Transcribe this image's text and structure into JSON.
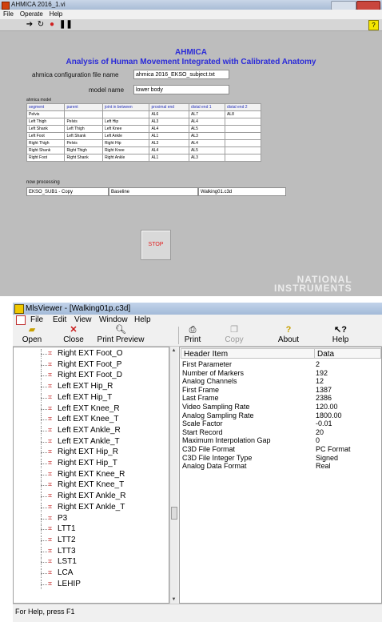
{
  "ahmica": {
    "title": "AHMICA 2016_1.vi",
    "menu": [
      "File",
      "Operate",
      "Help"
    ],
    "heading1": "AHMICA",
    "heading2": "Analysis of Human Movement Integrated with Calibrated Anatomy",
    "config_label": "ahmica configuration file name",
    "config_value": "ahmica 2016_EKSO_subject.txt",
    "model_label": "model name",
    "model_value": "lower body",
    "table_caption": "ahmica model",
    "table_headers": [
      "segment",
      "parent",
      "joint in between",
      "proximal end",
      "distal end 1",
      "distal end 2"
    ],
    "table_rows": [
      [
        "Pelvis",
        "",
        "",
        "AL6",
        "AL7",
        "AL8"
      ],
      [
        "Left Thigh",
        "Pelvis",
        "Left Hip",
        "AL3",
        "AL4",
        ""
      ],
      [
        "Left Shank",
        "Left Thigh",
        "Left Knee",
        "AL4",
        "AL5",
        ""
      ],
      [
        "Left Foot",
        "Left Shank",
        "Left Ankle",
        "AL1",
        "AL3",
        ""
      ],
      [
        "Right Thigh",
        "Pelvis",
        "Right Hip",
        "AL3",
        "AL4",
        ""
      ],
      [
        "Right Shank",
        "Right Thigh",
        "Right Knee",
        "AL4",
        "AL5",
        ""
      ],
      [
        "Right Foot",
        "Right Shank",
        "Right Ankle",
        "AL1",
        "AL3",
        ""
      ]
    ],
    "now_processing_label": "now processing",
    "processing": [
      "EKSO_SUB1 - Copy",
      "Baseline",
      "Walking01.c3d"
    ],
    "stop_label": "STOP",
    "ni_line1": "NATIONAL",
    "ni_line2": "INSTRUMENTS"
  },
  "mls": {
    "title": "MlsViewer - [Walking01p.c3d]",
    "menu": [
      "File",
      "Edit",
      "View",
      "Window",
      "Help"
    ],
    "toolbar": [
      {
        "label": "Open",
        "icon": "open-folder-icon",
        "enabled": true
      },
      {
        "label": "Close",
        "icon": "close-x-icon",
        "enabled": true
      },
      {
        "label": "Print Preview",
        "icon": "print-preview-icon",
        "enabled": true
      },
      {
        "label": "Print",
        "icon": "printer-icon",
        "enabled": true
      },
      {
        "label": "Copy",
        "icon": "copy-icon",
        "enabled": false
      },
      {
        "label": "About",
        "icon": "about-icon",
        "enabled": true
      },
      {
        "label": "Help",
        "icon": "help-icon",
        "enabled": true
      }
    ],
    "tree_items": [
      "Right EXT Foot_O",
      "Right EXT Foot_P",
      "Right EXT Foot_D",
      "Left EXT Hip_R",
      "Left EXT Hip_T",
      "Left EXT Knee_R",
      "Left EXT Knee_T",
      "Left EXT Ankle_R",
      "Left EXT Ankle_T",
      "Right EXT Hip_R",
      "Right EXT Hip_T",
      "Right EXT Knee_R",
      "Right EXT Knee_T",
      "Right EXT Ankle_R",
      "Right EXT Ankle_T",
      "P3",
      "LTT1",
      "LTT2",
      "LTT3",
      "LST1",
      "LCA",
      "LEHIP"
    ],
    "grid_headers": [
      "Header Item",
      "Data"
    ],
    "grid_rows": [
      [
        "First Parameter",
        "2"
      ],
      [
        "Number of Markers",
        "192"
      ],
      [
        "Analog Channels",
        "12"
      ],
      [
        "First Frame",
        "1387"
      ],
      [
        "Last Frame",
        "2386"
      ],
      [
        "Video Sampling Rate",
        "120.00"
      ],
      [
        "Analog Sampling Rate",
        "1800.00"
      ],
      [
        "Scale Factor",
        "-0.01"
      ],
      [
        "Start Record",
        "20"
      ],
      [
        "Maximum Interpolation Gap",
        "0"
      ],
      [
        "C3D File Format",
        "PC Format"
      ],
      [
        "C3D File Integer Type",
        "Signed"
      ],
      [
        "Analog Data Format",
        "Real"
      ]
    ],
    "status": "For Help, press F1"
  }
}
